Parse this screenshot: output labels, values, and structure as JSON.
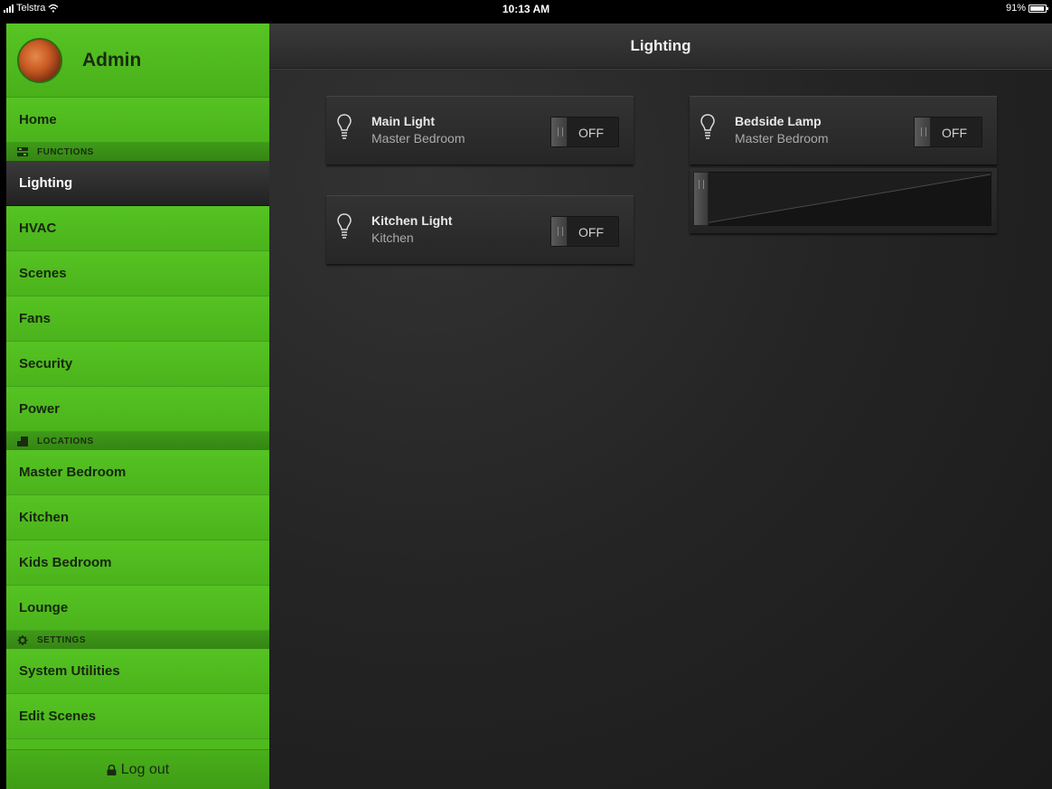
{
  "status_bar": {
    "carrier": "Telstra",
    "time": "10:13 AM",
    "battery_percent": "91%",
    "battery_level": 0.91
  },
  "sidebar": {
    "user_name": "Admin",
    "home_label": "Home",
    "functions_header": "FUNCTIONS",
    "functions": [
      {
        "label": "Lighting",
        "active": true
      },
      {
        "label": "HVAC"
      },
      {
        "label": "Scenes"
      },
      {
        "label": "Fans"
      },
      {
        "label": "Security"
      },
      {
        "label": "Power"
      }
    ],
    "locations_header": "LOCATIONS",
    "locations": [
      {
        "label": "Master Bedroom"
      },
      {
        "label": "Kitchen"
      },
      {
        "label": "Kids Bedroom"
      },
      {
        "label": "Lounge"
      }
    ],
    "settings_header": "SETTINGS",
    "settings": [
      {
        "label": "System Utilities"
      },
      {
        "label": "Edit Scenes"
      }
    ],
    "logout_label": "Log out"
  },
  "main": {
    "title": "Lighting",
    "devices": [
      {
        "name": "Main Light",
        "room": "Master Bedroom",
        "state": "OFF"
      },
      {
        "name": "Kitchen Light",
        "room": "Kitchen",
        "state": "OFF"
      },
      {
        "name": "Bedside Lamp",
        "room": "Master Bedroom",
        "state": "OFF",
        "dimmer_level": 0
      }
    ]
  },
  "colors": {
    "accent_green": "#4fba1e",
    "panel_dark": "#262626"
  },
  "icons": [
    "signal-icon",
    "wifi-icon",
    "battery-icon",
    "avatar",
    "functions-icon",
    "locations-icon",
    "settings-gear-icon",
    "lock-icon",
    "lightbulb-icon"
  ]
}
